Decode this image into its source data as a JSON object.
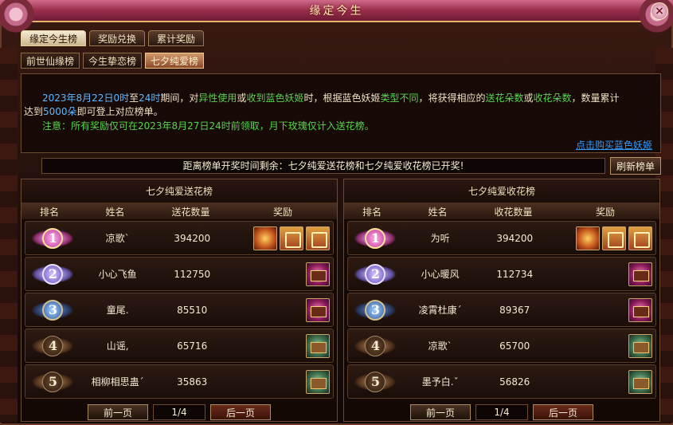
{
  "window": {
    "title": "缘定今生"
  },
  "tabs_primary": [
    {
      "label": "缘定今生榜",
      "active": true
    },
    {
      "label": "奖励兑换",
      "active": false
    },
    {
      "label": "累计奖励",
      "active": false
    }
  ],
  "tabs_secondary": [
    {
      "label": "前世仙缘榜",
      "active": false
    },
    {
      "label": "今生挚恋榜",
      "active": false
    },
    {
      "label": "七夕纯爱榜",
      "active": true
    }
  ],
  "info": {
    "p1": "2023年8月22日0时",
    "p2": "至",
    "p3": "24时",
    "p4": "期间，对",
    "p5": "异性使用",
    "p6": "或",
    "p7": "收到蓝色妖姬",
    "p8": "时，根据蓝色妖姬",
    "p9": "类型不同",
    "p10": "，将获得相应的",
    "p11": "送花朵数",
    "p12": "或",
    "p13": "收花朵数",
    "p14": "，数量累计",
    "p15": "达到",
    "p16": "5000朵",
    "p17": "即可登上对应榜单。",
    "notice": "注意：所有奖励仅可在2023年8月27日24时前领取，月下玫瑰仅计入送花榜。",
    "buy_link": "点击购买蓝色妖姬"
  },
  "countdown": "距离榜单开奖时间剩余：七夕纯爱送花榜和七夕纯爱收花榜已开奖!",
  "refresh_label": "刷新榜单",
  "boards": [
    {
      "title": "七夕纯爱送花榜",
      "headers": [
        "排名",
        "姓名",
        "送花数量",
        "奖励"
      ],
      "rows": [
        {
          "rank": "1",
          "name": "凉歌`",
          "value": "394200",
          "rewards": [
            "box-gold",
            "seal",
            "seal"
          ]
        },
        {
          "rank": "2",
          "name": "小心飞鱼",
          "value": "112750",
          "rewards": [
            "chest-purple"
          ]
        },
        {
          "rank": "3",
          "name": "童尾.",
          "value": "85510",
          "rewards": [
            "chest-purple"
          ]
        },
        {
          "rank": "4",
          "name": "山谣,",
          "value": "65716",
          "rewards": [
            "chest-green"
          ]
        },
        {
          "rank": "5",
          "name": "相柳相思蛊ˊ",
          "value": "35863",
          "rewards": [
            "chest-green"
          ]
        }
      ],
      "pager": {
        "prev": "前一页",
        "page": "1/4",
        "next": "后一页"
      }
    },
    {
      "title": "七夕纯爱收花榜",
      "headers": [
        "排名",
        "姓名",
        "收花数量",
        "奖励"
      ],
      "rows": [
        {
          "rank": "1",
          "name": "为听",
          "value": "394200",
          "rewards": [
            "box-gold",
            "seal",
            "seal"
          ]
        },
        {
          "rank": "2",
          "name": "小心暖风",
          "value": "112734",
          "rewards": [
            "chest-purple"
          ]
        },
        {
          "rank": "3",
          "name": "凌霄杜康ˊ",
          "value": "89367",
          "rewards": [
            "chest-purple"
          ]
        },
        {
          "rank": "4",
          "name": "凉歌`",
          "value": "65700",
          "rewards": [
            "chest-green"
          ]
        },
        {
          "rank": "5",
          "name": "墨予白.ˇ",
          "value": "56826",
          "rewards": [
            "chest-green"
          ]
        }
      ],
      "pager": {
        "prev": "前一页",
        "page": "1/4",
        "next": "后一页"
      }
    }
  ]
}
